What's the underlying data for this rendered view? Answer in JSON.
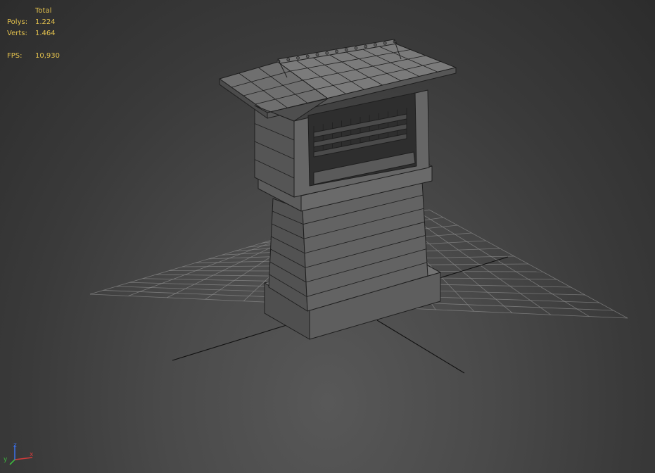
{
  "viewport": {
    "background": "#3a3a3a",
    "grid_color": "#8a8a8a",
    "axis_color": "#111111",
    "model_color": "#686868",
    "edge_color": "#1e1e1e"
  },
  "stats": {
    "header": "Total",
    "polys_label": "Polys:",
    "polys_value": "1.224",
    "verts_label": "Verts:",
    "verts_value": "1.464",
    "fps_label": "FPS:",
    "fps_value": "10,930",
    "text_color": "#e3c14d"
  },
  "gizmo": {
    "x_label": "x",
    "y_label": "y",
    "z_label": "z",
    "x_color": "#d43a3a",
    "y_color": "#3fb83f",
    "z_color": "#3b6de0"
  }
}
